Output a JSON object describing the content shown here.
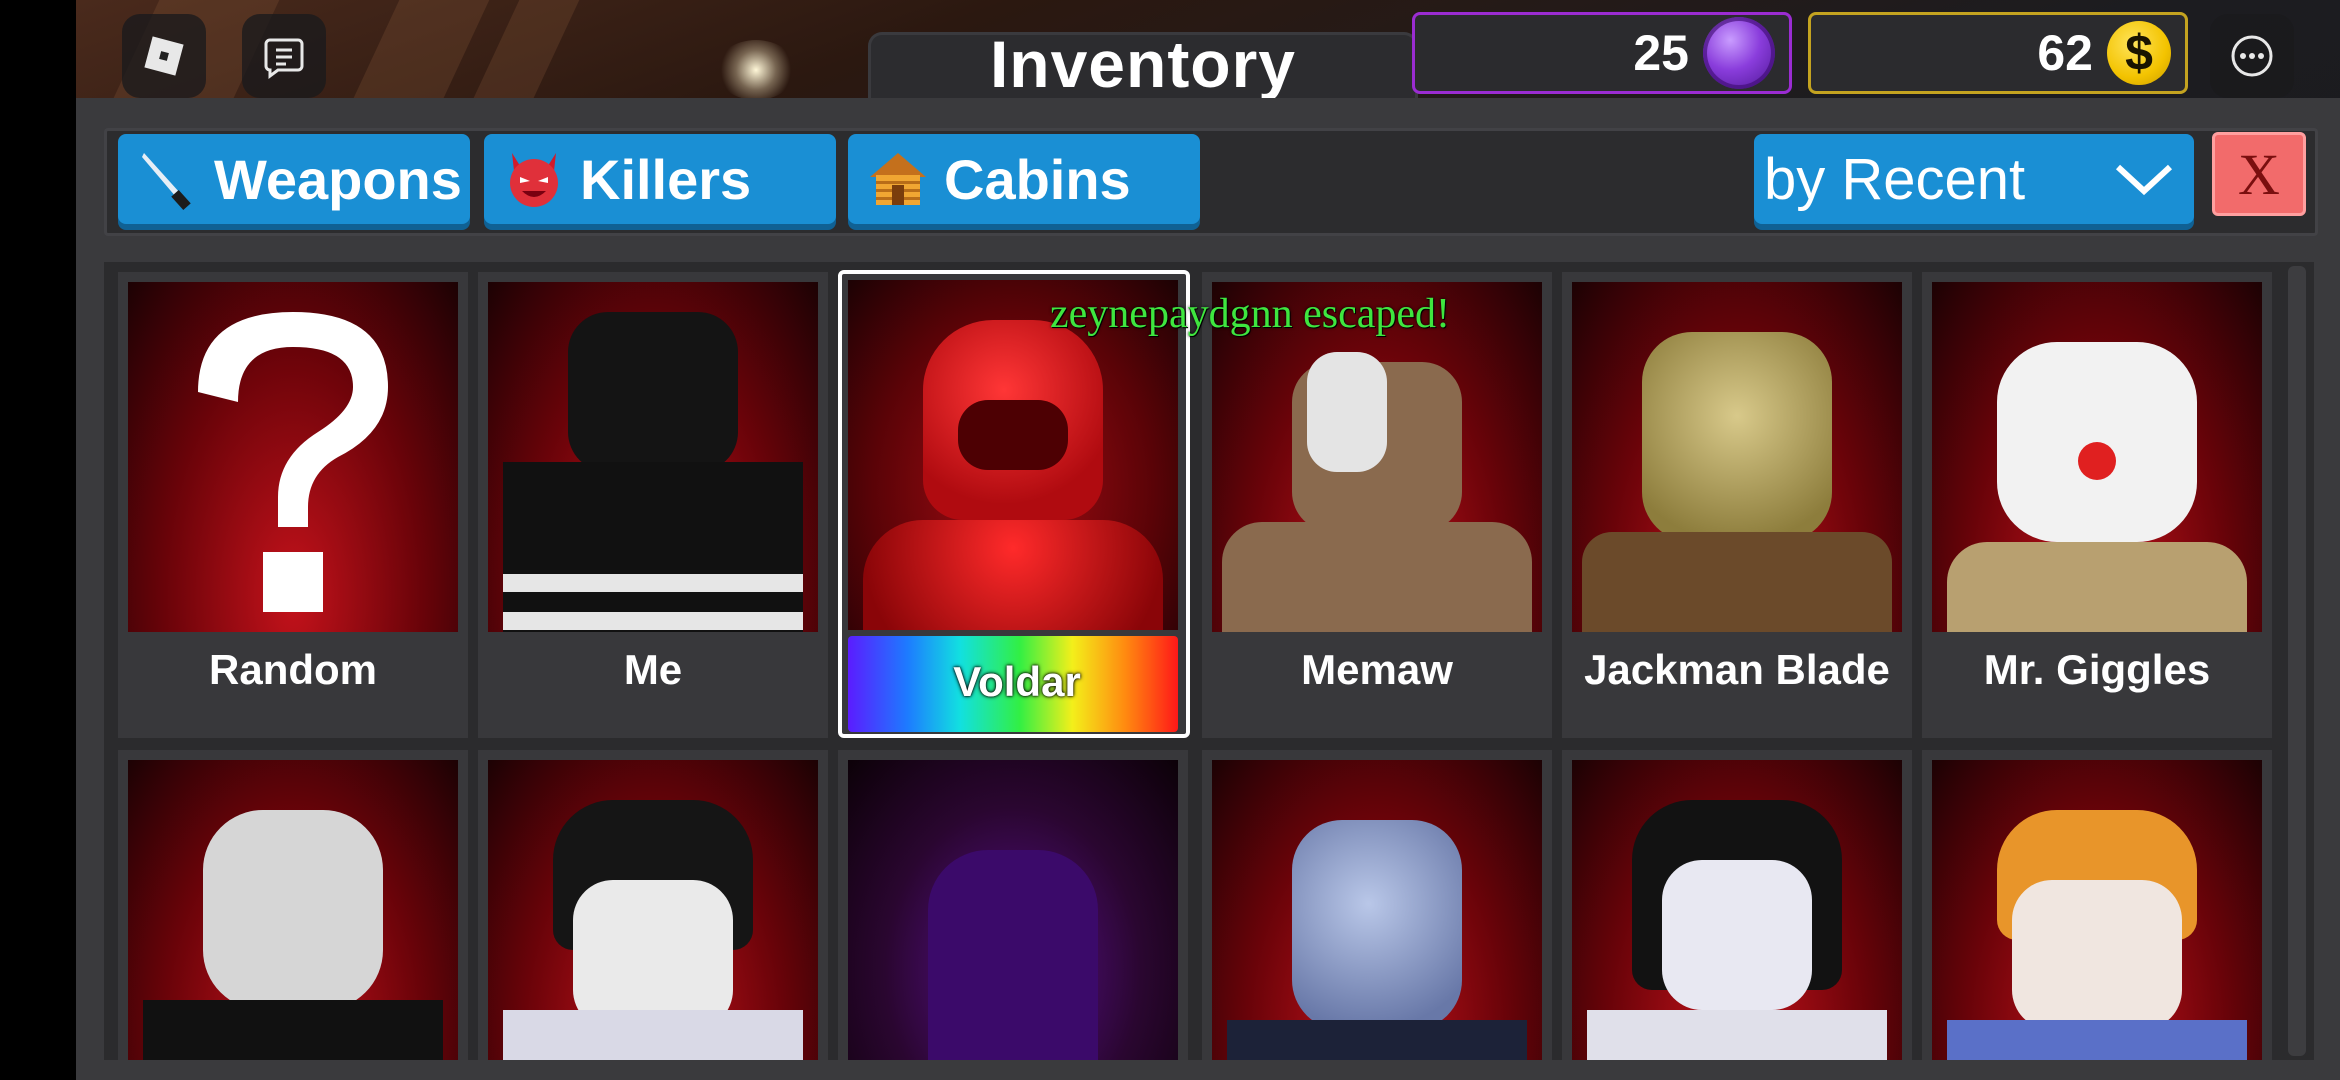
{
  "header": {
    "title": "Inventory",
    "gems": "25",
    "coins": "62",
    "coin_symbol": "$"
  },
  "tabs": [
    {
      "label": "Weapons",
      "icon": "knife-icon"
    },
    {
      "label": "Killers",
      "icon": "devil-icon"
    },
    {
      "label": "Cabins",
      "icon": "cabin-icon"
    }
  ],
  "sort": {
    "label": "by Recent"
  },
  "close_label": "X",
  "toast": "zeynepaydgnn escaped!",
  "cards_row1": [
    {
      "name": "Random",
      "icon": "question-mark-icon"
    },
    {
      "name": "Me"
    },
    {
      "name": "Voldar",
      "selected": true
    },
    {
      "name": "Memaw"
    },
    {
      "name": "Jackman Blade"
    },
    {
      "name": "Mr. Giggles"
    }
  ],
  "colors": {
    "accent_blue": "#1a8fd4",
    "gem_border": "#9b2cd2",
    "coin_border": "#c4a320",
    "close_red": "#f26b6b",
    "toast_green": "#3fe63f"
  }
}
